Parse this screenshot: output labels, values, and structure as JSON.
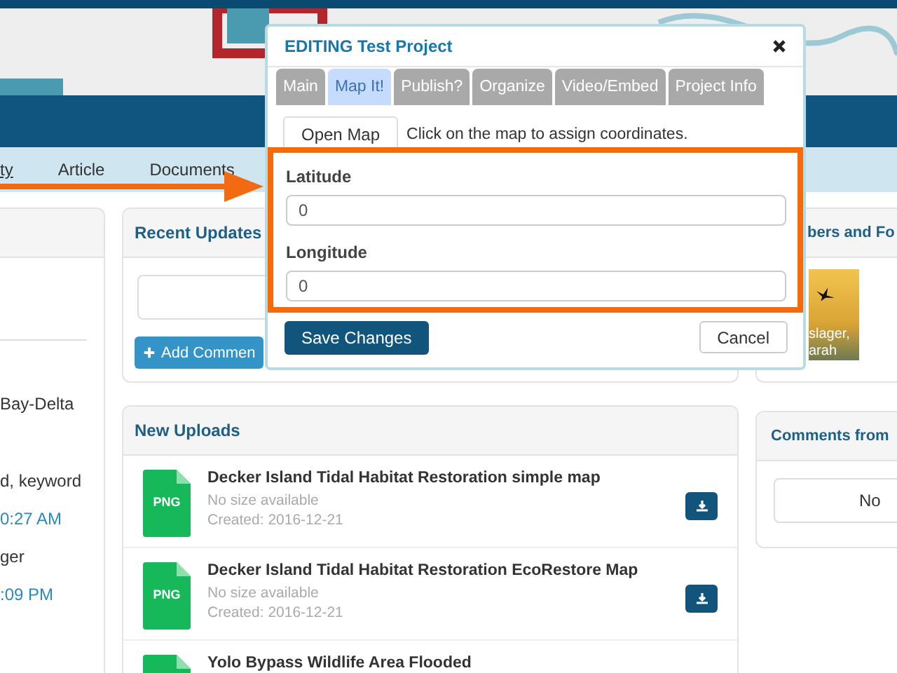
{
  "nav": {
    "items": [
      {
        "label": "ty",
        "selected": true
      },
      {
        "label": "Article",
        "selected": false
      },
      {
        "label": "Documents",
        "selected": false
      }
    ]
  },
  "left_panel": {
    "lines": [
      {
        "text": "Bay-Delta",
        "kind": "plain"
      },
      {
        "text": "d, keyword",
        "kind": "plain"
      },
      {
        "text": "0:27 AM",
        "kind": "link"
      },
      {
        "text": "ger",
        "kind": "plain"
      },
      {
        "text": ":09 PM",
        "kind": "link"
      }
    ]
  },
  "recent_updates": {
    "title": "Recent Updates",
    "button": "Add Commen"
  },
  "new_uploads": {
    "title": "New Uploads",
    "items": [
      {
        "type": "PNG",
        "title": "Decker Island Tidal Habitat Restoration simple map",
        "size": "No size available",
        "created": "Created: 2016-12-21"
      },
      {
        "type": "PNG",
        "title": "Decker Island Tidal Habitat Restoration EcoRestore Map",
        "size": "No size available",
        "created": "Created: 2016-12-21"
      },
      {
        "title": "Yolo Bypass Wildlife Area Flooded"
      }
    ]
  },
  "members_panel": {
    "title": "bers and Fo",
    "caption": [
      "slager,",
      "arah"
    ]
  },
  "comments_panel": {
    "title": "Comments from",
    "message": "No"
  },
  "dialog": {
    "title": "EDITING Test Project",
    "tabs": [
      {
        "label": "Main",
        "selected": false
      },
      {
        "label": "Map It!",
        "selected": true
      },
      {
        "label": "Publish?",
        "selected": false
      },
      {
        "label": "Organize",
        "selected": false
      },
      {
        "label": "Video/Embed",
        "selected": false
      },
      {
        "label": "Project Info",
        "selected": false
      }
    ],
    "open_map": "Open Map",
    "hint": "Click on the map to assign coordinates.",
    "fields": [
      {
        "label": "Latitude",
        "value": "0"
      },
      {
        "label": "Longitude",
        "value": "0"
      }
    ],
    "save": "Save Changes",
    "cancel": "Cancel"
  }
}
